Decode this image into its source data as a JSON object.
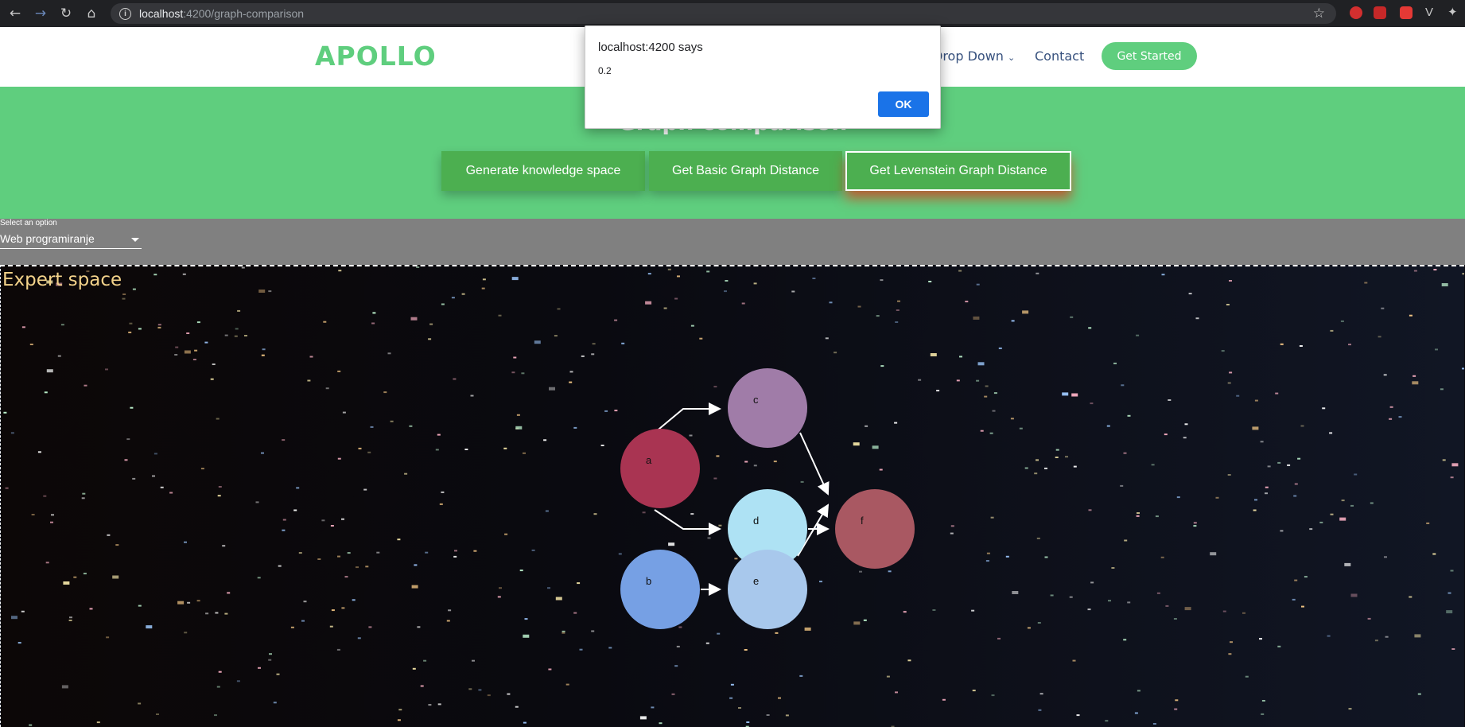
{
  "browser": {
    "url_host": "localhost",
    "url_rest": ":4200/graph-comparison",
    "icons": [
      "back-icon",
      "forward-icon",
      "reload-icon",
      "home-icon",
      "info-icon",
      "star-icon"
    ]
  },
  "header": {
    "logo": "APOLLO",
    "nav": [
      "Drop Down",
      "Contact"
    ],
    "cta": "Get Started",
    "brand_color": "#5fce7e"
  },
  "hero": {
    "title": "Graph comparison",
    "buttons": [
      "Generate knowledge space",
      "Get Basic Graph Distance",
      "Get Levenstein Graph Distance"
    ],
    "active_button": "Get Levenstein Graph Distance"
  },
  "select": {
    "label": "Select an option",
    "value": "Web programiranje"
  },
  "expert_space": {
    "title": "Expert space",
    "nodes": [
      {
        "id": "a",
        "color": "#a93452"
      },
      {
        "id": "b",
        "color": "#76a0e4"
      },
      {
        "id": "c",
        "color": "#a07ca8"
      },
      {
        "id": "d",
        "color": "#aee2f4"
      },
      {
        "id": "e",
        "color": "#a8c8ec"
      },
      {
        "id": "f",
        "color": "#a95862"
      }
    ],
    "edges": [
      [
        "a",
        "c"
      ],
      [
        "a",
        "d"
      ],
      [
        "b",
        "e"
      ],
      [
        "c",
        "f"
      ],
      [
        "d",
        "f"
      ],
      [
        "e",
        "f"
      ]
    ]
  },
  "dialog": {
    "title": "localhost:4200 says",
    "message": "0.2",
    "ok_label": "OK",
    "ok_color": "#1a73e8"
  }
}
